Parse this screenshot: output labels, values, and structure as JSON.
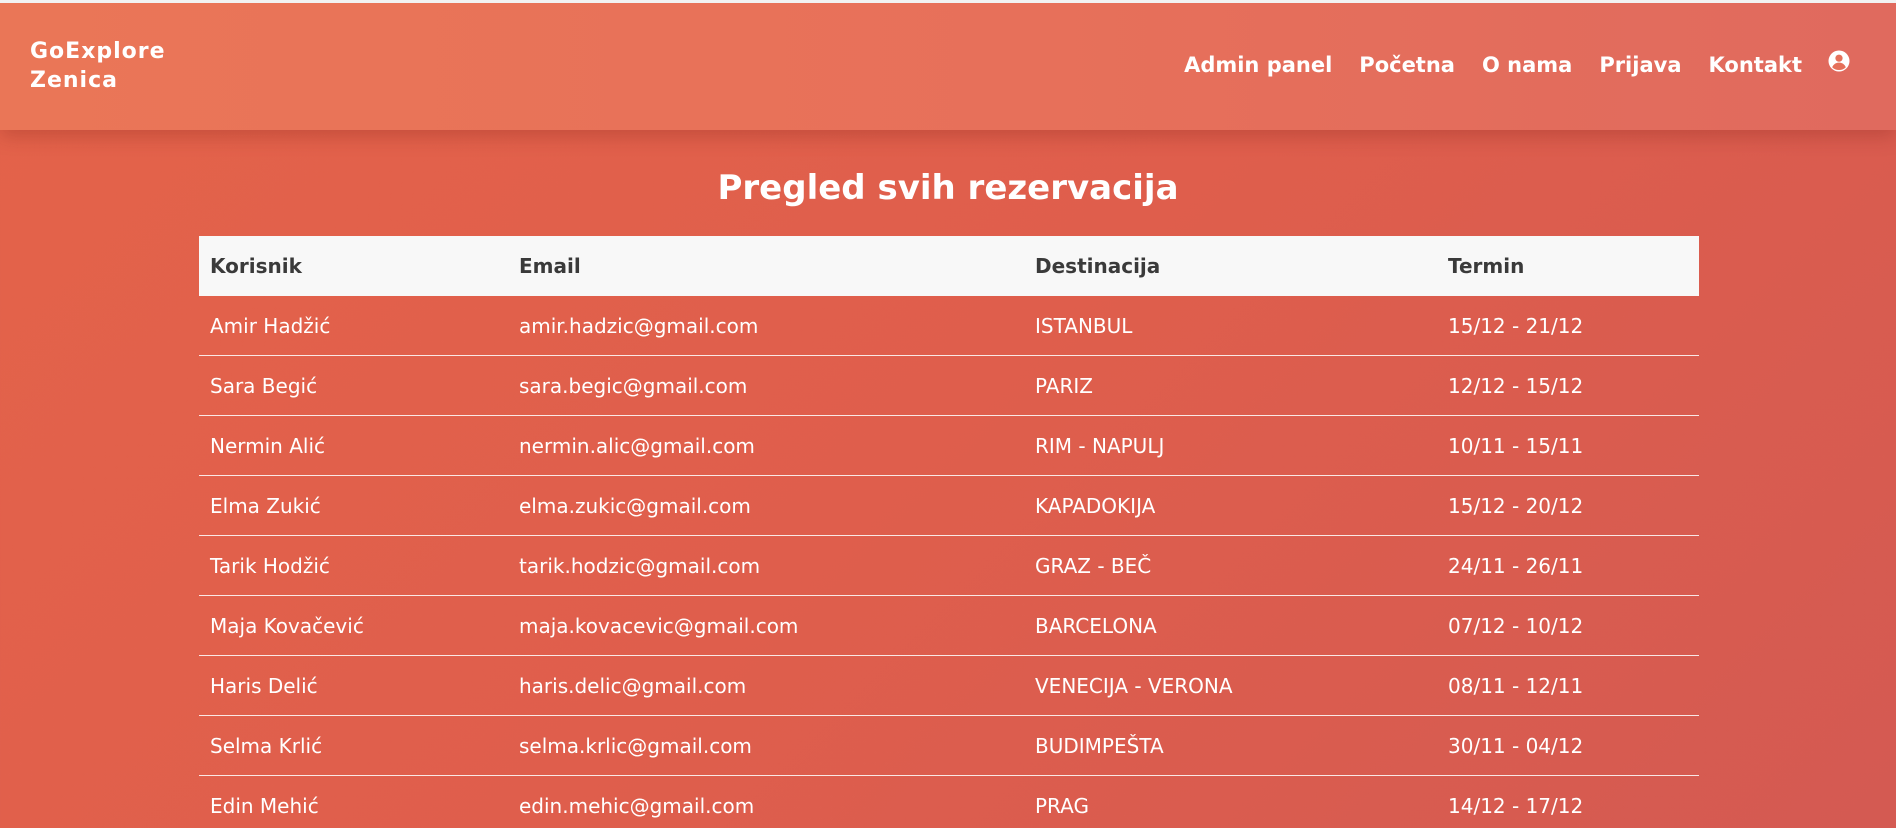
{
  "navbar": {
    "brand_line1": "GoExplore",
    "brand_line2": "Zenica",
    "links": [
      {
        "label": "Admin panel"
      },
      {
        "label": "Početna"
      },
      {
        "label": "O nama"
      },
      {
        "label": "Prijava"
      },
      {
        "label": "Kontakt"
      }
    ],
    "user_icon": "user-circle-icon"
  },
  "page": {
    "title": "Pregled svih rezervacija"
  },
  "table": {
    "headers": [
      "Korisnik",
      "Email",
      "Destinacija",
      "Termin"
    ],
    "rows": [
      [
        "Amir Hadžić",
        "amir.hadzic@gmail.com",
        "ISTANBUL",
        "15/12 - 21/12"
      ],
      [
        "Sara Begić",
        "sara.begic@gmail.com",
        "PARIZ",
        "12/12 - 15/12"
      ],
      [
        "Nermin Alić",
        "nermin.alic@gmail.com",
        "RIM - NAPULJ",
        "10/11 - 15/11"
      ],
      [
        "Elma Zukić",
        "elma.zukic@gmail.com",
        "KAPADOKIJA",
        "15/12 - 20/12"
      ],
      [
        "Tarik Hodžić",
        "tarik.hodzic@gmail.com",
        "GRAZ - BEČ",
        "24/11 - 26/11"
      ],
      [
        "Maja Kovačević",
        "maja.kovacevic@gmail.com",
        "BARCELONA",
        "07/12 - 10/12"
      ],
      [
        "Haris Delić",
        "haris.delic@gmail.com",
        "VENECIJA - VERONA",
        "08/11 - 12/11"
      ],
      [
        "Selma Krlić",
        "selma.krlic@gmail.com",
        "BUDIMPEŠTA",
        "30/11 - 04/12"
      ],
      [
        "Edin Mehić",
        "edin.mehic@gmail.com",
        "PRAG",
        "14/12 - 17/12"
      ]
    ]
  },
  "colors": {
    "background": "#df5e4c",
    "navbar": "#e7705a",
    "header_row": "#f8f8f8",
    "header_text": "#3a3a3a"
  }
}
